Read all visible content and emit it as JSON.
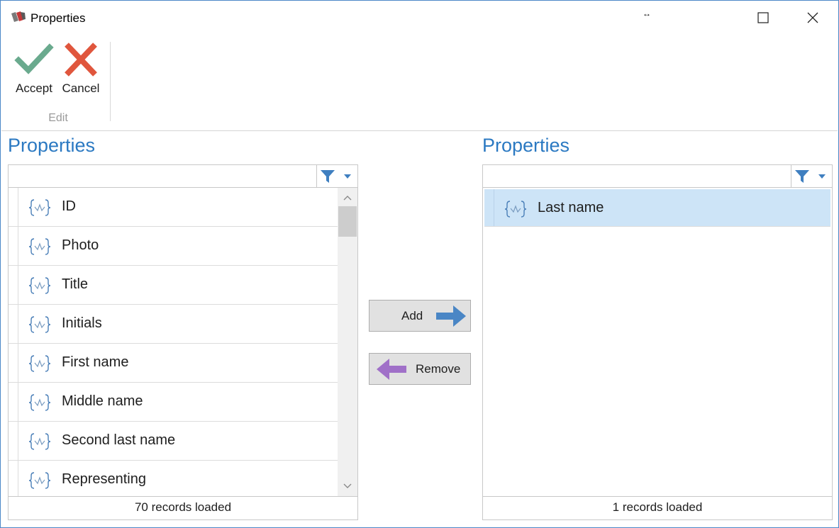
{
  "window": {
    "title": "Properties",
    "resize_hint": "↔"
  },
  "ribbon": {
    "accept_label": "Accept",
    "cancel_label": "Cancel",
    "group_label": "Edit"
  },
  "left_panel": {
    "title": "Properties",
    "items": [
      {
        "label": "ID",
        "icon": "property-braces-icon"
      },
      {
        "label": "Photo",
        "icon": "property-braces-icon"
      },
      {
        "label": "Title",
        "icon": "property-braces-icon"
      },
      {
        "label": "Initials",
        "icon": "property-braces-icon"
      },
      {
        "label": "First name",
        "icon": "property-braces-icon"
      },
      {
        "label": "Middle name",
        "icon": "property-braces-icon"
      },
      {
        "label": "Second last name",
        "icon": "property-braces-icon"
      },
      {
        "label": "Representing",
        "icon": "property-braces-icon"
      }
    ],
    "status": "70 records loaded"
  },
  "right_panel": {
    "title": "Properties",
    "items": [
      {
        "label": "Last name",
        "icon": "property-braces-icon",
        "selected": true
      }
    ],
    "status": "1 records loaded"
  },
  "actions": {
    "add_label": "Add",
    "remove_label": "Remove"
  },
  "colors": {
    "accent": "#2b79c2",
    "selection": "#cde4f7",
    "accept_green": "#6aaa8e",
    "cancel_red": "#e0563d",
    "add_arrow": "#4a86c5",
    "remove_arrow": "#a070c8"
  }
}
